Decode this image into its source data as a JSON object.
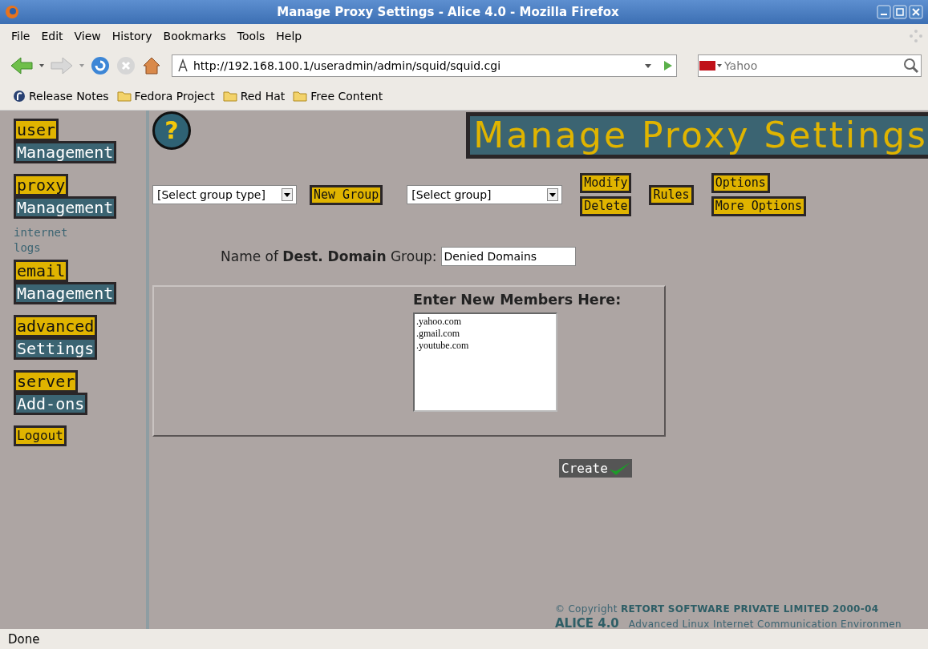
{
  "window": {
    "title": "Manage Proxy Settings - Alice 4.0 - Mozilla Firefox"
  },
  "menu_bar": [
    "File",
    "Edit",
    "View",
    "History",
    "Bookmarks",
    "Tools",
    "Help"
  ],
  "toolbar": {
    "url": "http://192.168.100.1/useradmin/admin/squid/squid.cgi",
    "search_placeholder": "Yahoo"
  },
  "bookmarks": [
    {
      "kind": "fedora",
      "label": "Release Notes"
    },
    {
      "kind": "folder",
      "label": "Fedora Project"
    },
    {
      "kind": "folder",
      "label": "Red Hat"
    },
    {
      "kind": "folder",
      "label": "Free Content"
    }
  ],
  "sidebar": {
    "items": [
      {
        "kind": "pair",
        "top": "user",
        "bottom": "Management"
      },
      {
        "kind": "pair",
        "top": "proxy",
        "bottom": "Management"
      },
      {
        "kind": "link",
        "label": "internet"
      },
      {
        "kind": "link",
        "label": "logs"
      },
      {
        "kind": "pair",
        "top": "email",
        "bottom": "Management"
      },
      {
        "kind": "pair",
        "top": "advanced",
        "bottom": "Settings"
      },
      {
        "kind": "pair",
        "top": "server",
        "bottom": "Add-ons"
      },
      {
        "kind": "single",
        "label": "Logout"
      }
    ]
  },
  "page": {
    "help_mark": "?",
    "title": "Manage Proxy Settings",
    "group_type_select": "[Select group type]",
    "new_group_button": "New Group",
    "group_select": "[Select group]",
    "action_columns": [
      [
        "Modify",
        "Delete"
      ],
      [
        "Rules"
      ],
      [
        "Options",
        "More Options"
      ]
    ],
    "name_label": "Name of **Dest. Domain** Group:",
    "name_value": "Denied Domains",
    "members_heading": "Enter New Members Here:",
    "members": [
      ".yahoo.com",
      ".gmail.com",
      ".youtube.com"
    ],
    "create_button": "Create",
    "copyright": "© Copyright **RETORT SOFTWARE PRIVATE LIMITED 2000-04**",
    "product": "ALICE 4.0",
    "product_tagline": "Advanced Linux Internet Communication Environmen"
  },
  "status_bar": "Done"
}
